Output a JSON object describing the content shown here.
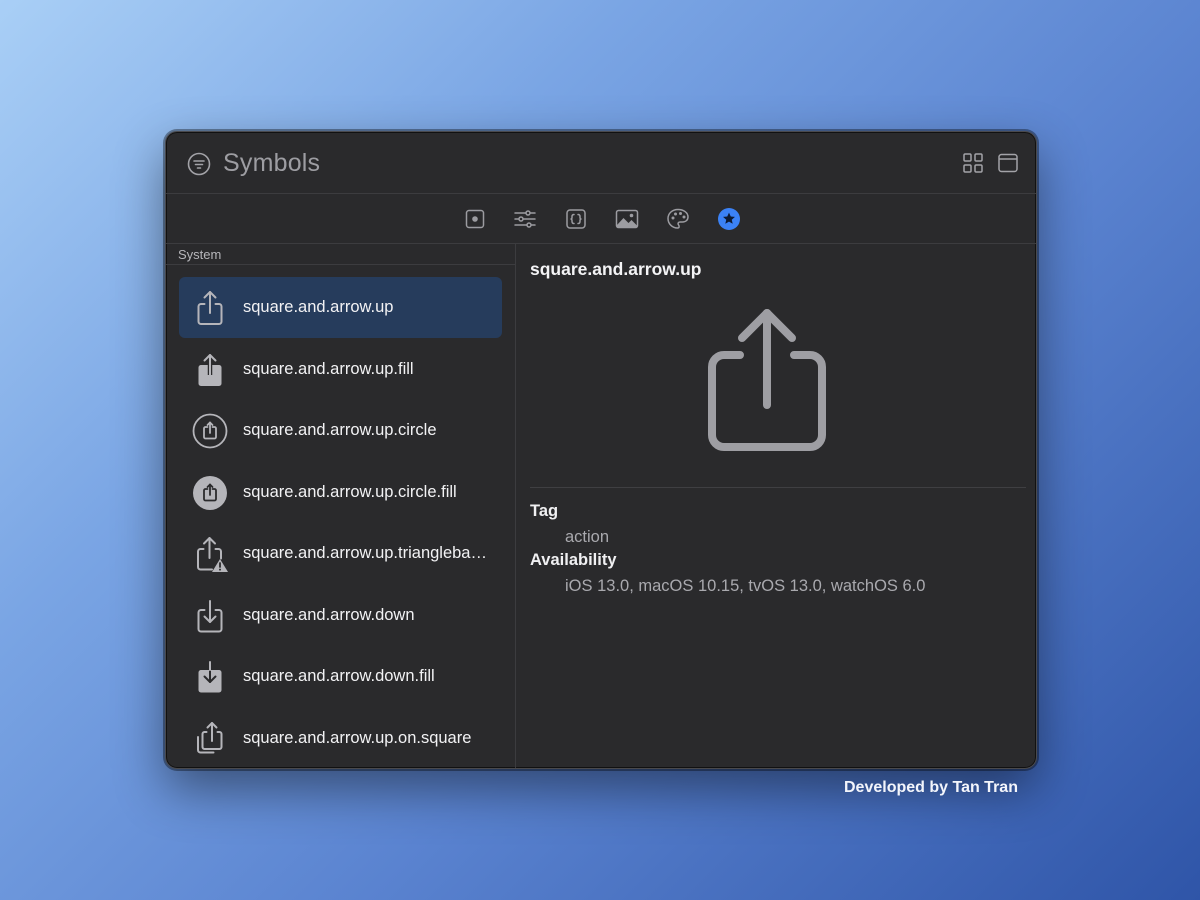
{
  "app": {
    "title": "Symbols"
  },
  "titlebar_icons": {
    "filter": "filter-circle-icon",
    "grid": "grid-view-icon",
    "sidebar": "window-panel-icon"
  },
  "toolbar": [
    {
      "name": "square-dot-icon"
    },
    {
      "name": "sliders-icon"
    },
    {
      "name": "code-braces-icon"
    },
    {
      "name": "photo-icon"
    },
    {
      "name": "palette-icon"
    },
    {
      "name": "star-circle-icon",
      "active": true
    }
  ],
  "accent_color": "#3b82f6",
  "sidebar": {
    "section": "System",
    "items": [
      {
        "label": "square.and.arrow.up",
        "icon": "square-and-arrow-up-icon",
        "selected": true
      },
      {
        "label": "square.and.arrow.up.fill",
        "icon": "square-and-arrow-up-fill-icon"
      },
      {
        "label": "square.and.arrow.up.circle",
        "icon": "square-and-arrow-up-circle-icon"
      },
      {
        "label": "square.and.arrow.up.circle.fill",
        "icon": "square-and-arrow-up-circle-fill-icon"
      },
      {
        "label": "square.and.arrow.up.trianglebadge.exclamationmark",
        "icon": "square-and-arrow-up-trianglebadge-icon"
      },
      {
        "label": "square.and.arrow.down",
        "icon": "square-and-arrow-down-icon"
      },
      {
        "label": "square.and.arrow.down.fill",
        "icon": "square-and-arrow-down-fill-icon"
      },
      {
        "label": "square.and.arrow.up.on.square",
        "icon": "square-and-arrow-up-on-square-icon"
      }
    ]
  },
  "detail": {
    "title": "square.and.arrow.up",
    "tag_heading": "Tag",
    "tag_value": "action",
    "availability_heading": "Availability",
    "availability_value": "iOS 13.0, macOS 10.15, tvOS 13.0, watchOS 6.0"
  },
  "footer": {
    "credit": "Developed by Tan Tran"
  }
}
